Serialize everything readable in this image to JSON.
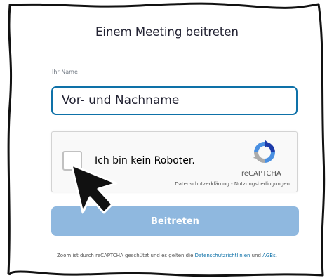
{
  "dialog": {
    "title": "Einem Meeting beitreten",
    "name_label": "Ihr Name",
    "name_value": "Vor- und Nachname"
  },
  "recaptcha": {
    "checkbox_label": "Ich bin kein Roboter.",
    "brand": "reCAPTCHA",
    "privacy_link": "Datenschutzerklärung",
    "separator": " - ",
    "terms_link": "Nutzungsbedingungen",
    "logo_icon": "recaptcha-logo-icon"
  },
  "join_button": {
    "label": "Beitreten"
  },
  "footer": {
    "prefix": "Zoom ist durch reCAPTCHA geschützt und es gelten die ",
    "privacy_link": "Datenschutzrichtlinien",
    "middle": " und ",
    "terms_link": "AGBs",
    "suffix": "."
  },
  "colors": {
    "accent": "#0e71a8",
    "button_disabled": "#8fb8df",
    "text": "#232333"
  },
  "cursor_icon": "mouse-arrow-icon"
}
